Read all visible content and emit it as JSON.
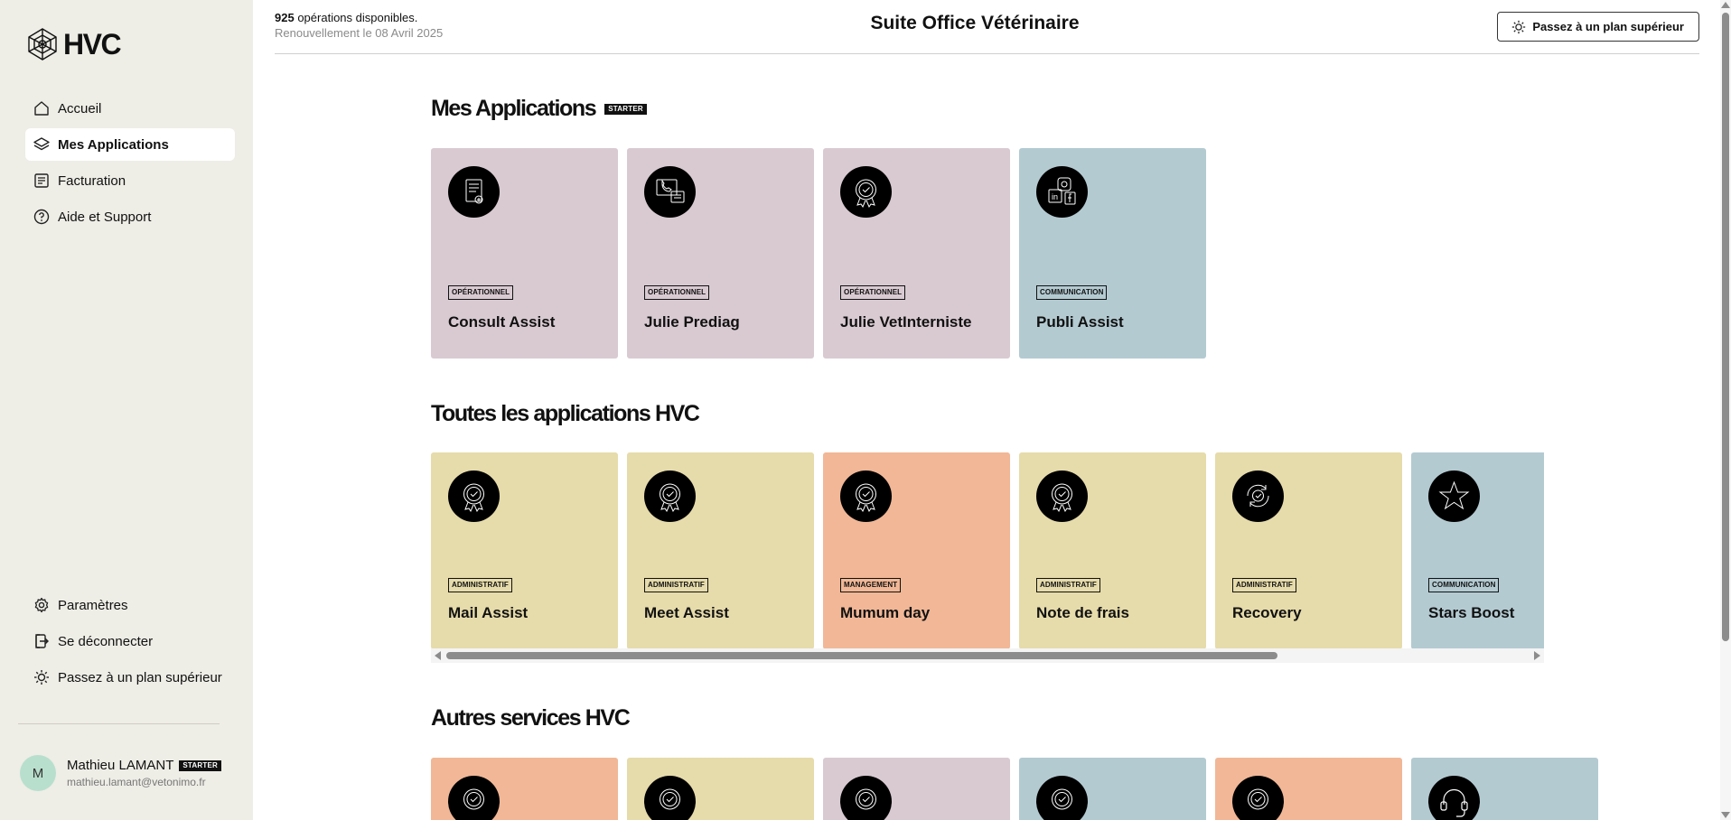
{
  "brand": {
    "name": "HVC"
  },
  "sidebar": {
    "nav": [
      {
        "label": "Accueil",
        "icon": "home-icon"
      },
      {
        "label": "Mes Applications",
        "icon": "layers-icon",
        "active": true
      },
      {
        "label": "Facturation",
        "icon": "document-icon"
      },
      {
        "label": "Aide et Support",
        "icon": "help-icon"
      }
    ],
    "bottom": [
      {
        "label": "Paramètres",
        "icon": "gear-icon"
      },
      {
        "label": "Se déconnecter",
        "icon": "logout-icon"
      },
      {
        "label": "Passez à un plan supérieur",
        "icon": "sparkle-icon"
      }
    ]
  },
  "user": {
    "initial": "M",
    "name": "Mathieu LAMANT",
    "plan": "STARTER",
    "email": "mathieu.lamant@vetonimo.fr"
  },
  "header": {
    "ops_count": "925",
    "ops_text": "opérations disponibles.",
    "renewal": "Renouvellement le 08 Avril 2025",
    "title": "Suite Office Vétérinaire",
    "upgrade_label": "Passez à un plan supérieur"
  },
  "sections": {
    "mine": {
      "title": "Mes Applications",
      "badge": "STARTER",
      "cards": [
        {
          "name": "Consult Assist",
          "tag": "OPÉRATIONNEL",
          "color": "#d9cad2",
          "icon": "document-audio-icon"
        },
        {
          "name": "Julie Prediag",
          "tag": "OPÉRATIONNEL",
          "color": "#d9cad2",
          "icon": "phone-chat-icon"
        },
        {
          "name": "Julie VetInterniste",
          "tag": "OPÉRATIONNEL",
          "color": "#d9cad2",
          "icon": "badge-check-icon"
        },
        {
          "name": "Publi Assist",
          "tag": "COMMUNICATION",
          "color": "#b3cad1",
          "icon": "social-icon"
        }
      ]
    },
    "all": {
      "title": "Toutes les applications HVC",
      "cards": [
        {
          "name": "Mail Assist",
          "tag": "ADMINISTRATIF",
          "color": "#e6dbaa",
          "icon": "award-icon"
        },
        {
          "name": "Meet Assist",
          "tag": "ADMINISTRATIF",
          "color": "#e6dbaa",
          "icon": "award-icon"
        },
        {
          "name": "Mumum day",
          "tag": "MANAGEMENT",
          "color": "#f1b796",
          "icon": "award-icon"
        },
        {
          "name": "Note de frais",
          "tag": "ADMINISTRATIF",
          "color": "#e6dbaa",
          "icon": "award-icon"
        },
        {
          "name": "Recovery",
          "tag": "ADMINISTRATIF",
          "color": "#e6dbaa",
          "icon": "refresh-check-icon"
        },
        {
          "name": "Stars Boost",
          "tag": "COMMUNICATION",
          "color": "#b3cad1",
          "icon": "star-icon"
        }
      ]
    },
    "others": {
      "title": "Autres services HVC",
      "cards": [
        {
          "color": "#f1b796",
          "icon": "award-icon"
        },
        {
          "color": "#e6dbaa",
          "icon": "award-icon"
        },
        {
          "color": "#d9cad2",
          "icon": "award-icon"
        },
        {
          "color": "#b3cad1",
          "icon": "award-icon"
        },
        {
          "color": "#f1b796",
          "icon": "award-icon"
        },
        {
          "color": "#b3cad1",
          "icon": "headset-icon"
        }
      ]
    }
  }
}
